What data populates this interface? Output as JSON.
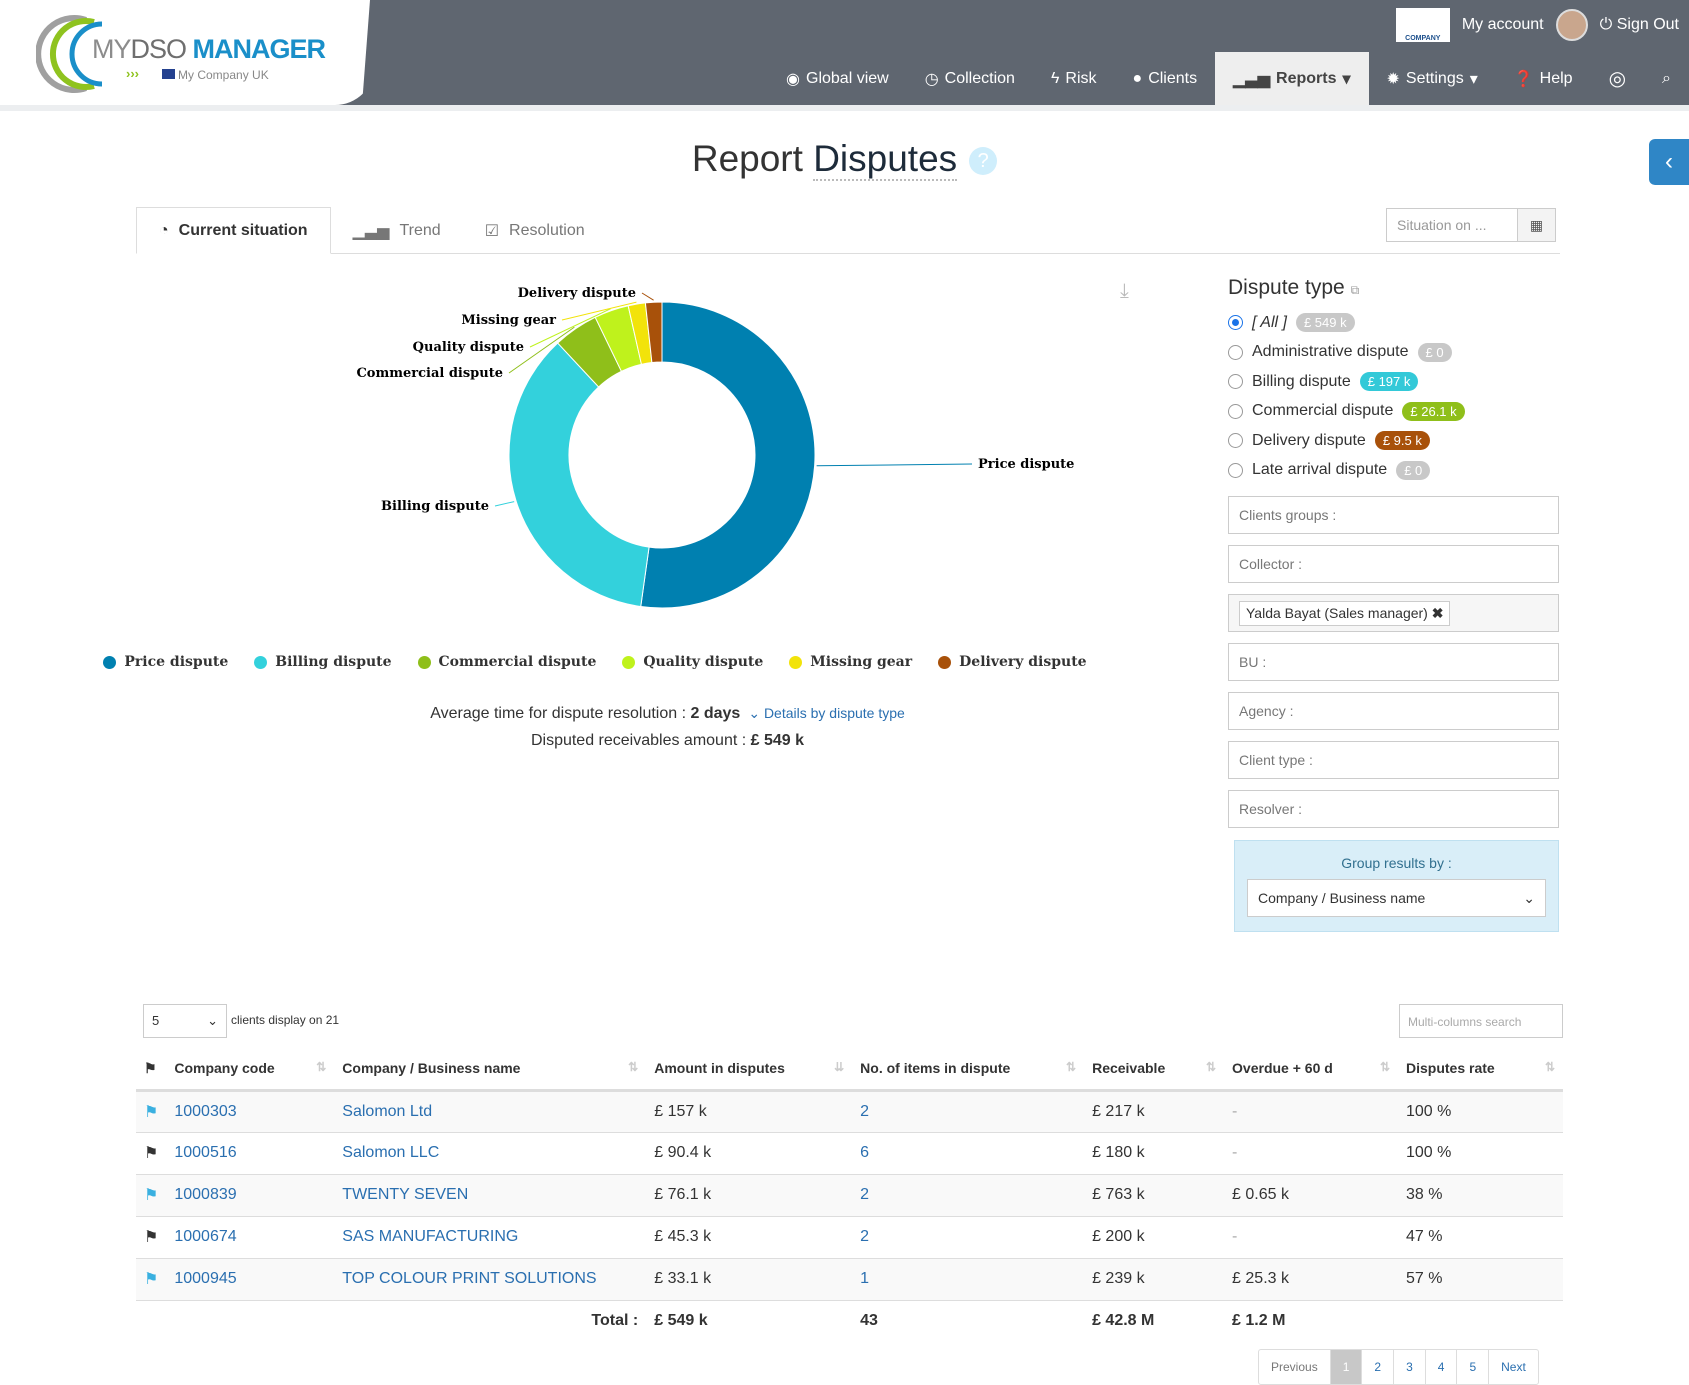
{
  "header": {
    "logo": {
      "my": "MY",
      "dso": "DSO",
      "manager": "MANAGER",
      "company": "My Company UK"
    },
    "company_logo": "COMPANY",
    "my_account": "My account",
    "sign_out": "Sign Out",
    "nav": [
      {
        "label": "Global view",
        "icon": "eye-icon"
      },
      {
        "label": "Collection",
        "icon": "clock-icon"
      },
      {
        "label": "Risk",
        "icon": "bolt-icon"
      },
      {
        "label": "Clients",
        "icon": "globe-icon"
      },
      {
        "label": "Reports",
        "icon": "bar-chart-icon",
        "active": true
      },
      {
        "label": "Settings",
        "icon": "gear-icon"
      },
      {
        "label": "Help",
        "icon": "help-icon"
      }
    ]
  },
  "page": {
    "title_a": "Report",
    "title_b": "Disputes"
  },
  "tabs": [
    {
      "label": "Current situation",
      "active": true
    },
    {
      "label": "Trend"
    },
    {
      "label": "Resolution"
    }
  ],
  "situation_placeholder": "Situation on ...",
  "chart_data": {
    "type": "pie",
    "donut": true,
    "unit": "£ k",
    "categories": [
      "Price dispute",
      "Billing dispute",
      "Commercial dispute",
      "Quality dispute",
      "Missing gear",
      "Delivery dispute"
    ],
    "values": [
      287,
      197,
      26.1,
      20,
      10,
      9.5
    ],
    "colors": [
      "#0080b0",
      "#33d1dc",
      "#8fbf1a",
      "#bff21c",
      "#f2e30a",
      "#a8510a"
    ]
  },
  "stats": {
    "avg_label": "Average time for dispute resolution :",
    "avg_value": "2 days",
    "details": "Details by dispute type",
    "amount_label": "Disputed receivables amount :",
    "amount_value": "£ 549 k"
  },
  "filters": {
    "title": "Dispute type",
    "types": [
      {
        "label": "[ All ]",
        "badge": "£ 549 k",
        "color": "#c8c8c8",
        "checked": true
      },
      {
        "label": "Administrative dispute",
        "badge": "£ 0",
        "color": "#c8c8c8"
      },
      {
        "label": "Billing dispute",
        "badge": "£ 197 k",
        "color": "#33c9d8"
      },
      {
        "label": "Commercial dispute",
        "badge": "£ 26.1 k",
        "color": "#8fbf1a"
      },
      {
        "label": "Delivery dispute",
        "badge": "£ 9.5 k",
        "color": "#a8510a"
      },
      {
        "label": "Late arrival dispute",
        "badge": "£ 0",
        "color": "#c8c8c8"
      }
    ],
    "clients_groups": "Clients groups :",
    "collector": "Collector :",
    "collector_tag": "Yalda Bayat (Sales manager)",
    "bu": "BU :",
    "agency": "Agency :",
    "client_type": "Client type :",
    "resolver": "Resolver :",
    "group_label": "Group results by :",
    "group_value": "Company / Business name"
  },
  "table": {
    "page_length": "5",
    "display_info": "clients display on 21",
    "search_placeholder": "Multi-columns search",
    "columns": [
      "Company code",
      "Company / Business name",
      "Amount in disputes",
      "No. of items in dispute",
      "Receivable",
      "Overdue + 60 d",
      "Disputes rate"
    ],
    "rows": [
      {
        "flag": "#3ab0e0",
        "code": "1000303",
        "name": "Salomon Ltd",
        "amount": "£ 157 k",
        "items": "2",
        "receivable": "£ 217 k",
        "overdue": "-",
        "rate": "100 %"
      },
      {
        "flag": "#333",
        "code": "1000516",
        "name": "Salomon LLC",
        "amount": "£ 90.4 k",
        "items": "6",
        "receivable": "£ 180 k",
        "overdue": "-",
        "rate": "100 %"
      },
      {
        "flag": "#3ab0e0",
        "code": "1000839",
        "name": "TWENTY SEVEN",
        "amount": "£ 76.1 k",
        "items": "2",
        "receivable": "£ 763 k",
        "overdue": "£ 0.65 k",
        "rate": "38 %"
      },
      {
        "flag": "#333",
        "code": "1000674",
        "name": "SAS MANUFACTURING",
        "amount": "£ 45.3 k",
        "items": "2",
        "receivable": "£ 200 k",
        "overdue": "-",
        "rate": "47 %"
      },
      {
        "flag": "#3ab0e0",
        "code": "1000945",
        "name": "TOP COLOUR PRINT SOLUTIONS",
        "amount": "£ 33.1 k",
        "items": "1",
        "receivable": "£ 239 k",
        "overdue": "£ 25.3 k",
        "rate": "57 %"
      }
    ],
    "total": {
      "label": "Total :",
      "amount": "£ 549 k",
      "items": "43",
      "receivable": "£ 42.8 M",
      "overdue": "£ 1.2 M"
    }
  },
  "pager": {
    "previous": "Previous",
    "pages": [
      "1",
      "2",
      "3",
      "4",
      "5"
    ],
    "current": "1",
    "next": "Next"
  }
}
